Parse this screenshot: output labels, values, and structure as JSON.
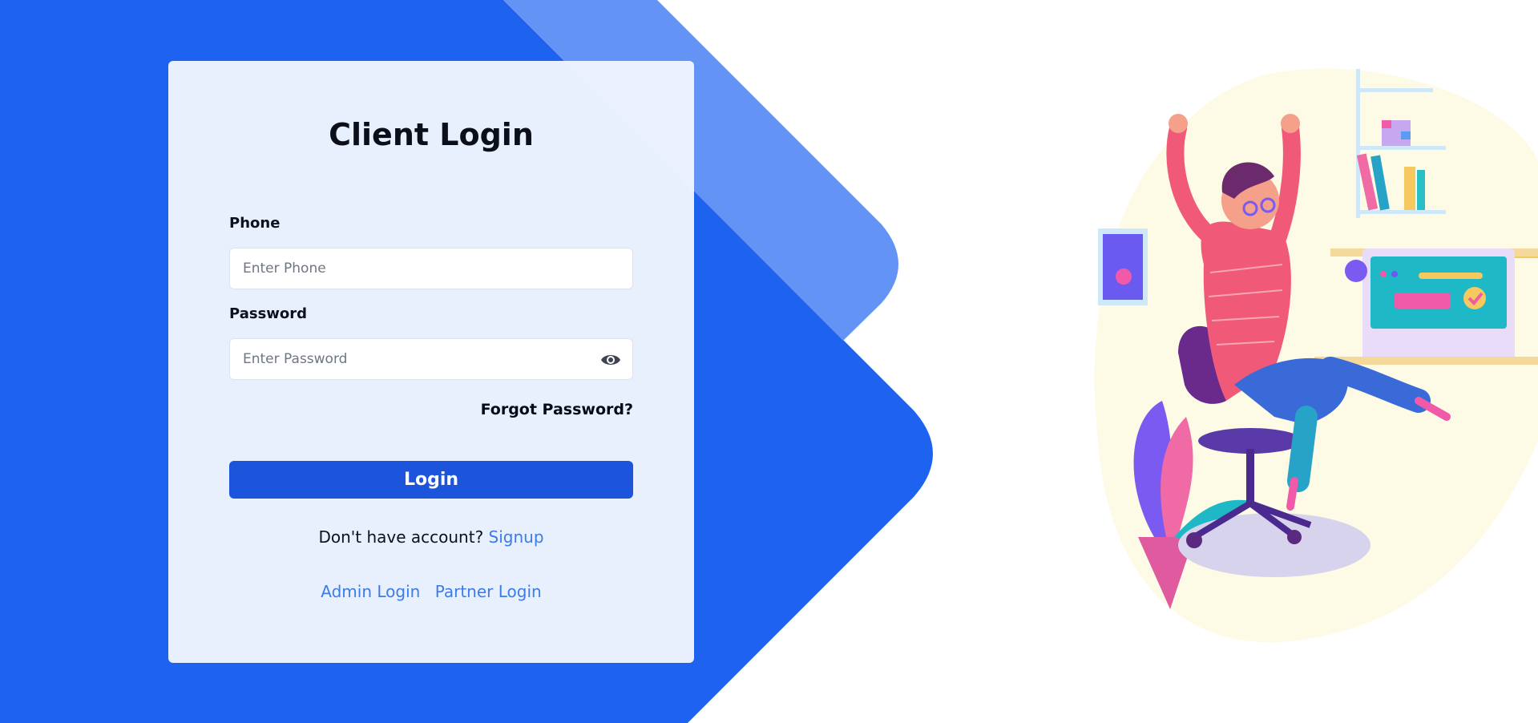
{
  "login": {
    "title": "Client Login",
    "phone": {
      "label": "Phone",
      "placeholder": "Enter Phone",
      "value": ""
    },
    "password": {
      "label": "Password",
      "placeholder": "Enter Password",
      "value": "",
      "toggle_icon": "eye-icon"
    },
    "forgot_label": "Forgot Password?",
    "submit_label": "Login",
    "signup_prompt": "Don't have account?",
    "signup_link": "Signup",
    "admin_login": "Admin Login",
    "partner_login": "Partner Login"
  },
  "theme": {
    "primary": "#1c55dc",
    "background_blue": "#1e63f0",
    "background_blue_light": "#6394f5",
    "card_background": "#f1f6fd",
    "link_color": "#3d7be8"
  },
  "illustration": {
    "icon": "happy-person-at-desk-illustration"
  }
}
